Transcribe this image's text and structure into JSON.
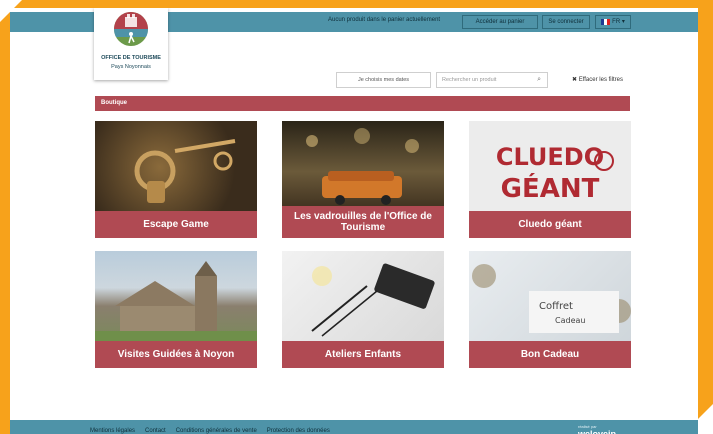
{
  "header": {
    "cart_message": "Aucun produit dans le panier actuellement",
    "view_cart_label": "Accéder au panier",
    "login_label": "Se connecter",
    "language_label": "FR ▾"
  },
  "logo": {
    "line1": "OFFICE DE TOURISME",
    "line2": "Pays Noyonnais"
  },
  "filters": {
    "choose_dates_label": "Je choisis mes dates",
    "search_placeholder": "Rechercher un produit",
    "clear_label": "Effacer les filtres"
  },
  "section": {
    "title": "Boutique"
  },
  "products": [
    {
      "label": "Escape Game"
    },
    {
      "label": "Les vadrouilles de l'Office de Tourisme"
    },
    {
      "label": "Cluedo géant"
    },
    {
      "label": "Visites Guidées à Noyon"
    },
    {
      "label": "Ateliers Enfants"
    },
    {
      "label": "Bon Cadeau"
    }
  ],
  "cluedo_image_text": {
    "line1": "CLUEDO",
    "line2": "GÉANT"
  },
  "gift_image_text": {
    "line1": "Coffret",
    "line2": "Cadeau"
  },
  "footer": {
    "links": [
      "Mentions légales",
      "Contact",
      "Conditions générales de vente",
      "Protection des données"
    ],
    "brand_small": "réalisé par",
    "brand": "weloveip"
  },
  "colors": {
    "accent": "#b04a53",
    "header": "#4e93a8",
    "frame": "#f7a21b"
  }
}
